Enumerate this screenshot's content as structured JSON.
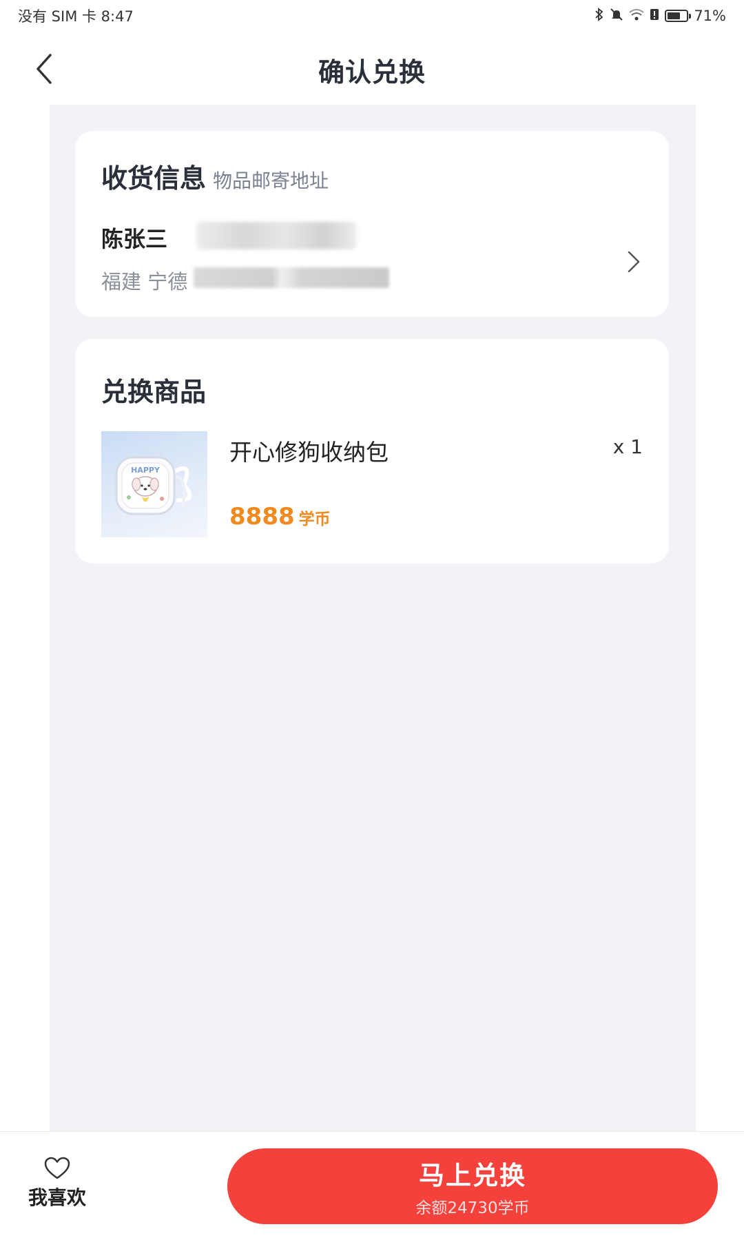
{
  "status_bar": {
    "carrier_time": "没有 SIM 卡 8:47",
    "battery_text": "71%",
    "battery_level": 0.71,
    "icons": [
      "bluetooth-icon",
      "mute-icon",
      "wifi-icon",
      "alert-icon",
      "battery-icon"
    ]
  },
  "header": {
    "title": "确认兑换",
    "back_icon": "chevron-left-icon"
  },
  "address_card": {
    "title": "收货信息",
    "subtitle": "物品邮寄地址",
    "recipient_name": "陈张三",
    "address": "福建 宁德"
  },
  "goods_card": {
    "title": "兑换商品",
    "item": {
      "name": "开心修狗收纳包",
      "quantity": "x 1",
      "price": "8888",
      "price_unit": "学币",
      "image_text": "HAPPY"
    }
  },
  "bottom_bar": {
    "favorite_label": "我喜欢",
    "redeem_label": "马上兑换",
    "balance_text": "余额24730学币"
  },
  "colors": {
    "accent_red": "#f5413b",
    "price_orange": "#f08a1e",
    "page_bg": "#f2f3f7"
  }
}
